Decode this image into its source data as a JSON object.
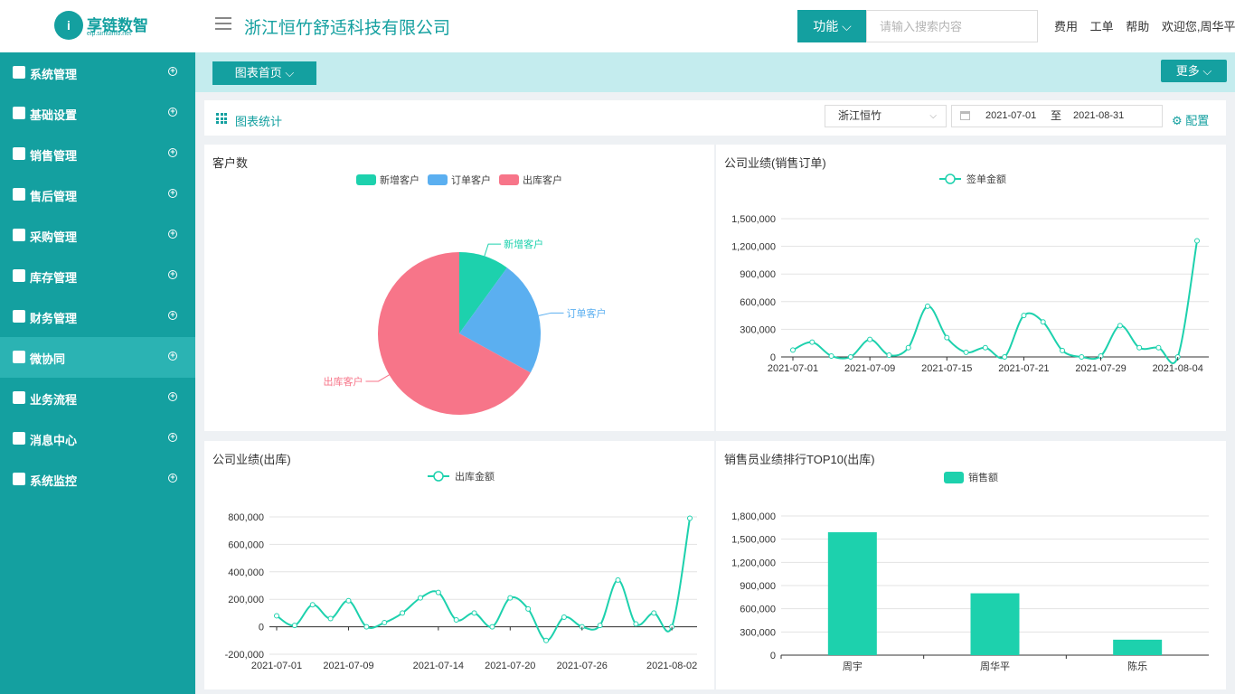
{
  "header": {
    "logo_name": "享链数智",
    "logo_sub": "eip.simuinfo.net",
    "logo_mark": "i",
    "company": "浙江恒竹舒适科技有限公司",
    "func_label": "功能 ⌵",
    "search_placeholder": "请输入搜索内容",
    "links": [
      "费用",
      "工单",
      "帮助",
      "欢迎您,周华平"
    ]
  },
  "sidebar": {
    "items": [
      {
        "label": "系统管理",
        "icon": "grid-icon"
      },
      {
        "label": "基础设置",
        "icon": "gear-icon"
      },
      {
        "label": "销售管理",
        "icon": "user-icon"
      },
      {
        "label": "售后管理",
        "icon": "badge-icon"
      },
      {
        "label": "采购管理",
        "icon": "clipboard-icon"
      },
      {
        "label": "库存管理",
        "icon": "warehouse-icon"
      },
      {
        "label": "财务管理",
        "icon": "yen-icon"
      },
      {
        "label": "微协同",
        "icon": "card-icon"
      },
      {
        "label": "业务流程",
        "icon": "flow-icon"
      },
      {
        "label": "消息中心",
        "icon": "mail-icon"
      },
      {
        "label": "系统监控",
        "icon": "location-icon"
      }
    ],
    "active_index": 7,
    "plus_glyph": "+"
  },
  "tabs": {
    "home_label": "图表首页 ⌵",
    "more_label": "更多 ⌵"
  },
  "toolbar": {
    "title": "图表统计",
    "company_select": "浙江恒竹",
    "chevron": "⌵",
    "date_from": "2021-07-01",
    "date_sep": "至",
    "date_to": "2021-08-31",
    "config_label": "⚙ 配置"
  },
  "colors": {
    "accent": "#14a0a0",
    "series": "#1dd1ad",
    "pie": [
      "#1dd1ad",
      "#5baff0",
      "#f77589"
    ]
  },
  "chart_data": [
    {
      "type": "pie",
      "title": "客户数",
      "labels": [
        "新增客户",
        "订单客户",
        "出库客户"
      ],
      "values": [
        10,
        23,
        67
      ],
      "legend": "top-center"
    },
    {
      "type": "line",
      "title": "公司业绩(销售订单)",
      "series": [
        {
          "name": "签单金额",
          "values": [
            75000,
            160000,
            10000,
            0,
            190000,
            20000,
            100000,
            550000,
            210000,
            50000,
            100000,
            0,
            450000,
            380000,
            70000,
            0,
            10000,
            340000,
            100000,
            100000,
            0,
            1260000
          ]
        }
      ],
      "x_tick_labels": [
        "2021-07-01",
        "2021-07-09",
        "2021-07-15",
        "2021-07-21",
        "2021-07-29",
        "2021-08-04"
      ],
      "y_ticks": [
        "0",
        "300,000",
        "600,000",
        "900,000",
        "1,200,000",
        "1,500,000"
      ],
      "ylim": [
        0,
        1500000
      ],
      "grid": true,
      "legend": "top-center"
    },
    {
      "type": "line",
      "title": "公司业绩(出库)",
      "series": [
        {
          "name": "出库金额",
          "values": [
            80000,
            10000,
            160000,
            60000,
            190000,
            0,
            30000,
            100000,
            210000,
            250000,
            50000,
            100000,
            0,
            210000,
            130000,
            -100000,
            70000,
            0,
            10000,
            340000,
            20000,
            100000,
            0,
            790000
          ]
        }
      ],
      "x_tick_labels": [
        "2021-07-01",
        "2021-07-09",
        "2021-07-14",
        "2021-07-20",
        "2021-07-26",
        "2021-08-02"
      ],
      "y_ticks": [
        "-200,000",
        "0",
        "200,000",
        "400,000",
        "600,000",
        "800,000"
      ],
      "ylim": [
        -200000,
        800000
      ],
      "grid": true,
      "legend": "top-center"
    },
    {
      "type": "bar",
      "title": "销售员业绩排行TOP10(出库)",
      "categories": [
        "周宇",
        "周华平",
        "陈乐"
      ],
      "series": [
        {
          "name": "销售额",
          "values": [
            1590000,
            800000,
            200000
          ]
        }
      ],
      "y_ticks": [
        "0",
        "300,000",
        "600,000",
        "900,000",
        "1,200,000",
        "1,500,000",
        "1,800,000"
      ],
      "ylim": [
        0,
        1800000
      ],
      "grid": true,
      "legend": "top-center"
    }
  ]
}
